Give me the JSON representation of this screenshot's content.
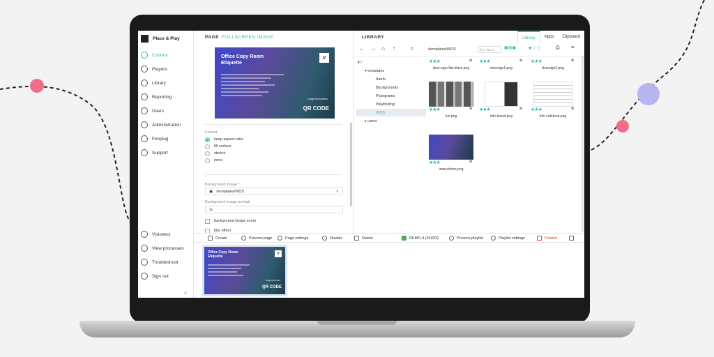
{
  "brand": {
    "name": "Place & Play"
  },
  "nav": {
    "items": [
      {
        "label": "Content",
        "icon": "content-icon",
        "active": true
      },
      {
        "label": "Players",
        "icon": "players-icon"
      },
      {
        "label": "Library",
        "icon": "library-icon"
      },
      {
        "label": "Reporting",
        "icon": "reporting-icon"
      },
      {
        "label": "Users",
        "icon": "users-icon"
      },
      {
        "label": "Administration",
        "icon": "administration-icon"
      },
      {
        "label": "Fireplug",
        "icon": "fireplug-icon"
      },
      {
        "label": "Support",
        "icon": "support-icon"
      }
    ],
    "bottom": [
      {
        "label": "Visionect",
        "icon": "visionect-icon"
      },
      {
        "label": "View processes",
        "icon": "processes-icon"
      },
      {
        "label": "Troubleshoot",
        "icon": "troubleshoot-icon"
      },
      {
        "label": "Sign out",
        "icon": "power-icon"
      }
    ],
    "collapse": "«"
  },
  "page_panel": {
    "title": "PAGE",
    "subtitle": "FULLSCREEN IMAGE",
    "preview": {
      "title_line1": "Office Copy Room",
      "title_line2": "Etiquette",
      "logo": "V",
      "qr": "QR CODE",
      "usage": "Usage instructions"
    },
    "format_label": "Format",
    "format_options": [
      {
        "label": "keep aspect ratio",
        "selected": true
      },
      {
        "label": "fill surface",
        "selected": false
      },
      {
        "label": "stretch",
        "selected": false
      },
      {
        "label": "none",
        "selected": false
      }
    ],
    "bg_image_label": "Background image *",
    "bg_image_value": "/templates/WDS",
    "bg_portrait_label": "Background image portrait",
    "bg_zoom_label": "background image zoom",
    "blur_label": "blur effect"
  },
  "library": {
    "title": "LIBRARY",
    "tabs": [
      "Library",
      "Apps",
      "Clipboard"
    ],
    "active_tab": "Library",
    "path": "/templates/WDS",
    "filter_placeholder": "filter library",
    "tree": [
      {
        "label": "/",
        "level": 0
      },
      {
        "label": "templates",
        "level": 1
      },
      {
        "label": "Alerts",
        "level": 2
      },
      {
        "label": "Backgrounds",
        "level": 2
      },
      {
        "label": "Pictograms",
        "level": 2
      },
      {
        "label": "Wayfinding",
        "level": 2
      },
      {
        "label": "WDS",
        "level": 2,
        "selected": true
      },
      {
        "label": "users",
        "level": 1
      }
    ],
    "files": [
      {
        "name": "door-sign-flat-black.png",
        "stars": "★★★"
      },
      {
        "name": "doorsign1.png",
        "stars": "★★★"
      },
      {
        "name": "doorsign2.png",
        "stars": "★★★"
      },
      {
        "name": "fun.png",
        "stars": "★★★"
      },
      {
        "name": "info board.png",
        "stars": "★★★"
      },
      {
        "name": "info cafeteria.png",
        "stars": "★★★"
      },
      {
        "name": "instructions.png",
        "stars": "★★★"
      }
    ]
  },
  "toolbar": {
    "create": "Create",
    "preview_page": "Preview page",
    "page_settings": "Page settings",
    "disable": "Disable",
    "delete": "Delete",
    "device": "DEMO-4 (31833)",
    "preview_playlist": "Preview playlist",
    "playlist_settings": "Playlist settings",
    "publish": "Publish"
  },
  "colors": {
    "accent": "#2bb5b5",
    "publish": "#e53935",
    "decor_pink": "#f06e8a",
    "decor_lavender": "#b7b5ef"
  }
}
